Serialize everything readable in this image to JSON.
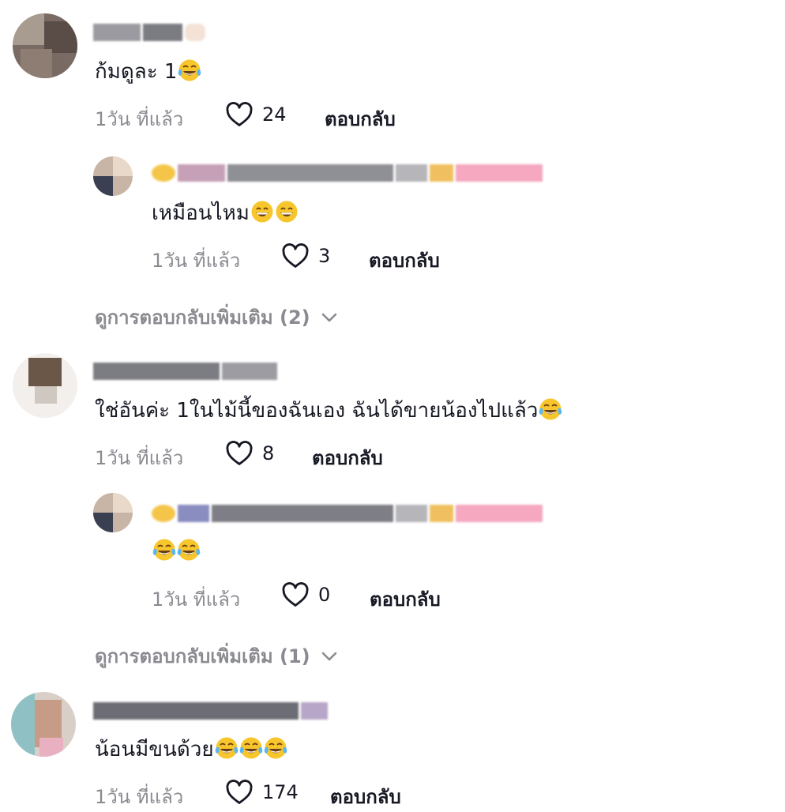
{
  "comments": [
    {
      "id": "c1",
      "text": "ก้มดูละ 1",
      "emoji_count": 1,
      "emoji": "tears-of-joy",
      "time": "1วัน ที่แล้ว",
      "likes": "24",
      "reply_label": "ตอบกลับ"
    },
    {
      "id": "r1",
      "text": "เหมือนไหม",
      "emoji_count": 2,
      "emoji": "grinning",
      "time": "1วัน ที่แล้ว",
      "likes": "3",
      "reply_label": "ตอบกลับ",
      "author_badge": "ผู้สร้าง"
    },
    {
      "id": "c2",
      "text": "ใช่อันค่ะ 1ในไม้นี้ของฉันเอง ฉันได้ขายน้องไปแล้ว",
      "emoji_count": 1,
      "emoji": "tears-of-joy",
      "time": "1วัน ที่แล้ว",
      "likes": "8",
      "reply_label": "ตอบกลับ"
    },
    {
      "id": "r2",
      "text": "",
      "emoji_count": 2,
      "emoji": "tears-of-joy",
      "time": "1วัน ที่แล้ว",
      "likes": "0",
      "reply_label": "ตอบกลับ",
      "author_badge": "ผู้สร้าง"
    },
    {
      "id": "c3",
      "text": "น้อนมีขนด้วย",
      "emoji_count": 3,
      "emoji": "tears-of-joy",
      "time": "1วัน ที่แล้ว",
      "likes": "174",
      "reply_label": "ตอบกลับ"
    }
  ],
  "view_more": [
    {
      "label": "ดูการตอบกลับเพิ่มเติม (2)"
    },
    {
      "label": "ดูการตอบกลับเพิ่มเติม (1)"
    }
  ],
  "icons": {
    "like": "heart-outline-icon",
    "expand": "chevron-down-icon"
  },
  "colors": {
    "text": "#161823",
    "secondary": "#8a8b91",
    "creator_badge": "#fe2c55"
  }
}
